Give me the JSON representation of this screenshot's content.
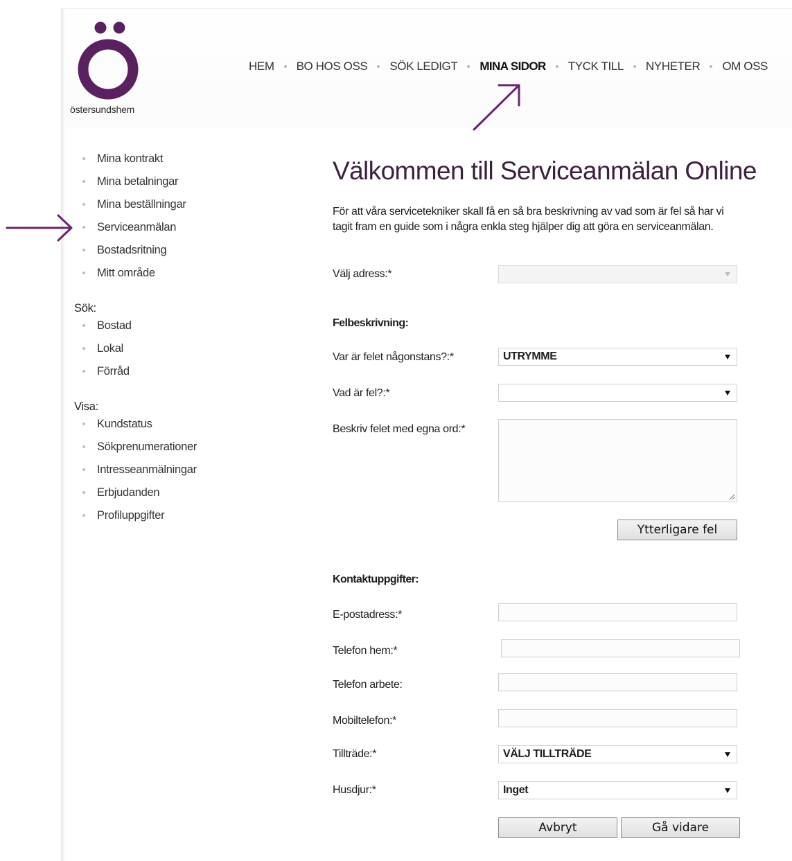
{
  "brand": {
    "logo_text": "östersundshem",
    "color": "#5a2161"
  },
  "nav": {
    "items": [
      {
        "label": "HEM"
      },
      {
        "label": "BO HOS OSS"
      },
      {
        "label": "SÖK LEDIGT"
      },
      {
        "label": "MINA SIDOR",
        "active": true
      },
      {
        "label": "TYCK TILL"
      },
      {
        "label": "NYHETER"
      },
      {
        "label": "OM OSS"
      }
    ]
  },
  "sidebar": {
    "mina_sidor": [
      {
        "label": "Mina kontrakt"
      },
      {
        "label": "Mina betalningar"
      },
      {
        "label": "Mina beställningar"
      },
      {
        "label": "Serviceanmälan",
        "active": true
      },
      {
        "label": "Bostadsritning"
      },
      {
        "label": "Mitt område"
      }
    ],
    "sok_heading": "Sök:",
    "sok": [
      {
        "label": "Bostad"
      },
      {
        "label": "Lokal"
      },
      {
        "label": "Förråd"
      }
    ],
    "visa_heading": "Visa:",
    "visa": [
      {
        "label": "Kundstatus"
      },
      {
        "label": "Sökprenumerationer"
      },
      {
        "label": "Intresseanmälningar"
      },
      {
        "label": "Erbjudanden"
      },
      {
        "label": "Profiluppgifter"
      }
    ]
  },
  "main": {
    "title": "Välkommen till Serviceanmälan Online",
    "intro": "För att våra servicetekniker skall få en så bra beskrivning av vad som är fel så har vi tagit fram en guide som i några enkla steg hjälper dig att göra en serviceanmälan.",
    "address": {
      "label": "Välj adress:*",
      "value": ""
    },
    "fault_section": "Felbeskrivning:",
    "location": {
      "label": "Var är felet någonstans?:*",
      "value": "UTRYMME"
    },
    "fault": {
      "label": "Vad är fel?:*",
      "value": ""
    },
    "description": {
      "label": "Beskriv felet med egna ord:*",
      "value": ""
    },
    "more_faults_button": "Ytterligare fel",
    "contact_section": "Kontaktuppgifter:",
    "email": {
      "label": "E-postadress:*",
      "value": ""
    },
    "phone_home": {
      "label": "Telefon hem:*",
      "value": ""
    },
    "phone_work": {
      "label": "Telefon arbete:",
      "value": ""
    },
    "mobile": {
      "label": "Mobiltelefon:*",
      "value": ""
    },
    "access": {
      "label": "Tillträde:*",
      "value": "VÄLJ TILLTRÄDE"
    },
    "pets": {
      "label": "Husdjur:*",
      "value": "Inget"
    },
    "cancel_button": "Avbryt",
    "next_button": "Gå vidare"
  }
}
